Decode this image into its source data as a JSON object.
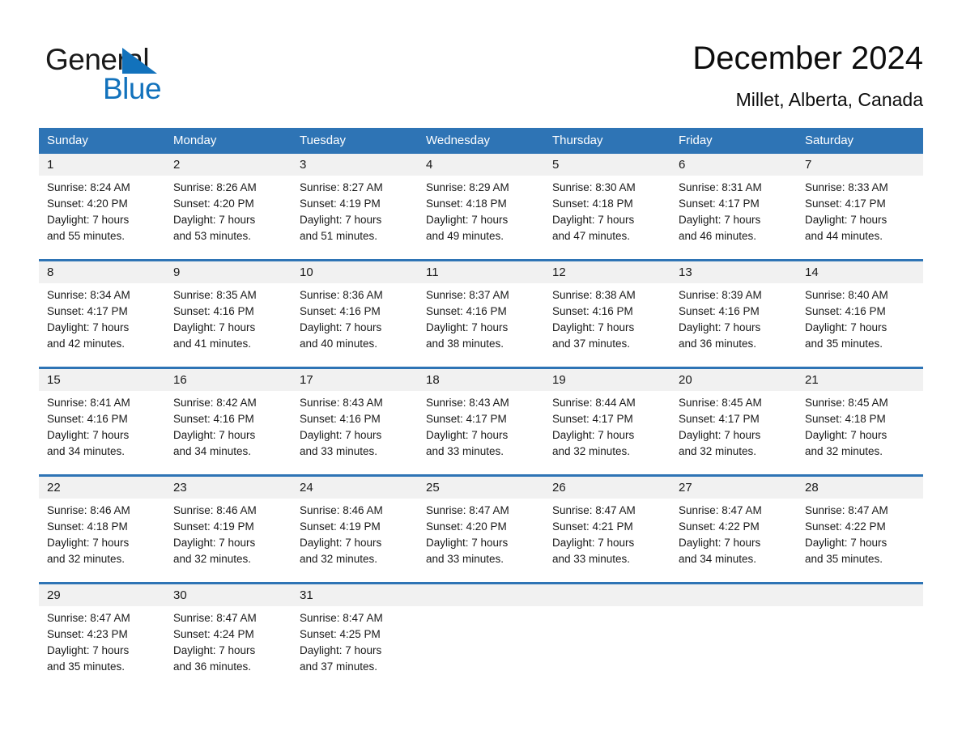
{
  "logo": {
    "word1": "General",
    "word2": "Blue",
    "triangle_color": "#1272bc"
  },
  "header": {
    "month_title": "December 2024",
    "location": "Millet, Alberta, Canada",
    "accent_color": "#2e74b5",
    "daynum_band_color": "#f1f1f1"
  },
  "weekdays": [
    "Sunday",
    "Monday",
    "Tuesday",
    "Wednesday",
    "Thursday",
    "Friday",
    "Saturday"
  ],
  "weeks": [
    {
      "daynums": [
        "1",
        "2",
        "3",
        "4",
        "5",
        "6",
        "7"
      ],
      "cells": [
        {
          "sunrise": "Sunrise: 8:24 AM",
          "sunset": "Sunset: 4:20 PM",
          "daylight1": "Daylight: 7 hours",
          "daylight2": "and 55 minutes."
        },
        {
          "sunrise": "Sunrise: 8:26 AM",
          "sunset": "Sunset: 4:20 PM",
          "daylight1": "Daylight: 7 hours",
          "daylight2": "and 53 minutes."
        },
        {
          "sunrise": "Sunrise: 8:27 AM",
          "sunset": "Sunset: 4:19 PM",
          "daylight1": "Daylight: 7 hours",
          "daylight2": "and 51 minutes."
        },
        {
          "sunrise": "Sunrise: 8:29 AM",
          "sunset": "Sunset: 4:18 PM",
          "daylight1": "Daylight: 7 hours",
          "daylight2": "and 49 minutes."
        },
        {
          "sunrise": "Sunrise: 8:30 AM",
          "sunset": "Sunset: 4:18 PM",
          "daylight1": "Daylight: 7 hours",
          "daylight2": "and 47 minutes."
        },
        {
          "sunrise": "Sunrise: 8:31 AM",
          "sunset": "Sunset: 4:17 PM",
          "daylight1": "Daylight: 7 hours",
          "daylight2": "and 46 minutes."
        },
        {
          "sunrise": "Sunrise: 8:33 AM",
          "sunset": "Sunset: 4:17 PM",
          "daylight1": "Daylight: 7 hours",
          "daylight2": "and 44 minutes."
        }
      ]
    },
    {
      "daynums": [
        "8",
        "9",
        "10",
        "11",
        "12",
        "13",
        "14"
      ],
      "cells": [
        {
          "sunrise": "Sunrise: 8:34 AM",
          "sunset": "Sunset: 4:17 PM",
          "daylight1": "Daylight: 7 hours",
          "daylight2": "and 42 minutes."
        },
        {
          "sunrise": "Sunrise: 8:35 AM",
          "sunset": "Sunset: 4:16 PM",
          "daylight1": "Daylight: 7 hours",
          "daylight2": "and 41 minutes."
        },
        {
          "sunrise": "Sunrise: 8:36 AM",
          "sunset": "Sunset: 4:16 PM",
          "daylight1": "Daylight: 7 hours",
          "daylight2": "and 40 minutes."
        },
        {
          "sunrise": "Sunrise: 8:37 AM",
          "sunset": "Sunset: 4:16 PM",
          "daylight1": "Daylight: 7 hours",
          "daylight2": "and 38 minutes."
        },
        {
          "sunrise": "Sunrise: 8:38 AM",
          "sunset": "Sunset: 4:16 PM",
          "daylight1": "Daylight: 7 hours",
          "daylight2": "and 37 minutes."
        },
        {
          "sunrise": "Sunrise: 8:39 AM",
          "sunset": "Sunset: 4:16 PM",
          "daylight1": "Daylight: 7 hours",
          "daylight2": "and 36 minutes."
        },
        {
          "sunrise": "Sunrise: 8:40 AM",
          "sunset": "Sunset: 4:16 PM",
          "daylight1": "Daylight: 7 hours",
          "daylight2": "and 35 minutes."
        }
      ]
    },
    {
      "daynums": [
        "15",
        "16",
        "17",
        "18",
        "19",
        "20",
        "21"
      ],
      "cells": [
        {
          "sunrise": "Sunrise: 8:41 AM",
          "sunset": "Sunset: 4:16 PM",
          "daylight1": "Daylight: 7 hours",
          "daylight2": "and 34 minutes."
        },
        {
          "sunrise": "Sunrise: 8:42 AM",
          "sunset": "Sunset: 4:16 PM",
          "daylight1": "Daylight: 7 hours",
          "daylight2": "and 34 minutes."
        },
        {
          "sunrise": "Sunrise: 8:43 AM",
          "sunset": "Sunset: 4:16 PM",
          "daylight1": "Daylight: 7 hours",
          "daylight2": "and 33 minutes."
        },
        {
          "sunrise": "Sunrise: 8:43 AM",
          "sunset": "Sunset: 4:17 PM",
          "daylight1": "Daylight: 7 hours",
          "daylight2": "and 33 minutes."
        },
        {
          "sunrise": "Sunrise: 8:44 AM",
          "sunset": "Sunset: 4:17 PM",
          "daylight1": "Daylight: 7 hours",
          "daylight2": "and 32 minutes."
        },
        {
          "sunrise": "Sunrise: 8:45 AM",
          "sunset": "Sunset: 4:17 PM",
          "daylight1": "Daylight: 7 hours",
          "daylight2": "and 32 minutes."
        },
        {
          "sunrise": "Sunrise: 8:45 AM",
          "sunset": "Sunset: 4:18 PM",
          "daylight1": "Daylight: 7 hours",
          "daylight2": "and 32 minutes."
        }
      ]
    },
    {
      "daynums": [
        "22",
        "23",
        "24",
        "25",
        "26",
        "27",
        "28"
      ],
      "cells": [
        {
          "sunrise": "Sunrise: 8:46 AM",
          "sunset": "Sunset: 4:18 PM",
          "daylight1": "Daylight: 7 hours",
          "daylight2": "and 32 minutes."
        },
        {
          "sunrise": "Sunrise: 8:46 AM",
          "sunset": "Sunset: 4:19 PM",
          "daylight1": "Daylight: 7 hours",
          "daylight2": "and 32 minutes."
        },
        {
          "sunrise": "Sunrise: 8:46 AM",
          "sunset": "Sunset: 4:19 PM",
          "daylight1": "Daylight: 7 hours",
          "daylight2": "and 32 minutes."
        },
        {
          "sunrise": "Sunrise: 8:47 AM",
          "sunset": "Sunset: 4:20 PM",
          "daylight1": "Daylight: 7 hours",
          "daylight2": "and 33 minutes."
        },
        {
          "sunrise": "Sunrise: 8:47 AM",
          "sunset": "Sunset: 4:21 PM",
          "daylight1": "Daylight: 7 hours",
          "daylight2": "and 33 minutes."
        },
        {
          "sunrise": "Sunrise: 8:47 AM",
          "sunset": "Sunset: 4:22 PM",
          "daylight1": "Daylight: 7 hours",
          "daylight2": "and 34 minutes."
        },
        {
          "sunrise": "Sunrise: 8:47 AM",
          "sunset": "Sunset: 4:22 PM",
          "daylight1": "Daylight: 7 hours",
          "daylight2": "and 35 minutes."
        }
      ]
    },
    {
      "daynums": [
        "29",
        "30",
        "31",
        "",
        "",
        "",
        ""
      ],
      "cells": [
        {
          "sunrise": "Sunrise: 8:47 AM",
          "sunset": "Sunset: 4:23 PM",
          "daylight1": "Daylight: 7 hours",
          "daylight2": "and 35 minutes."
        },
        {
          "sunrise": "Sunrise: 8:47 AM",
          "sunset": "Sunset: 4:24 PM",
          "daylight1": "Daylight: 7 hours",
          "daylight2": "and 36 minutes."
        },
        {
          "sunrise": "Sunrise: 8:47 AM",
          "sunset": "Sunset: 4:25 PM",
          "daylight1": "Daylight: 7 hours",
          "daylight2": "and 37 minutes."
        },
        {
          "sunrise": "",
          "sunset": "",
          "daylight1": "",
          "daylight2": ""
        },
        {
          "sunrise": "",
          "sunset": "",
          "daylight1": "",
          "daylight2": ""
        },
        {
          "sunrise": "",
          "sunset": "",
          "daylight1": "",
          "daylight2": ""
        },
        {
          "sunrise": "",
          "sunset": "",
          "daylight1": "",
          "daylight2": ""
        }
      ]
    }
  ]
}
